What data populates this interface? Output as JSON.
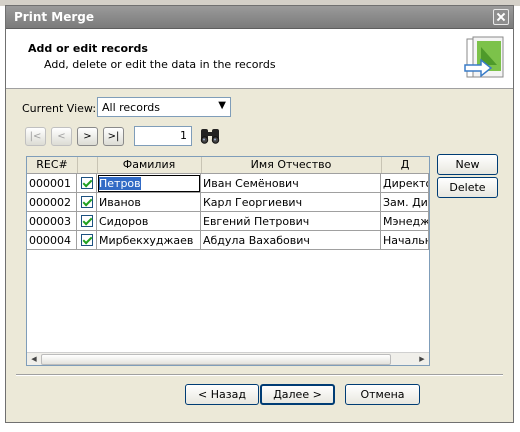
{
  "window": {
    "title": "Print Merge"
  },
  "header": {
    "title": "Add or edit records",
    "subtitle": "Add, delete or edit the data in the records"
  },
  "view": {
    "label": "Current View:",
    "selected": "All records"
  },
  "navigator": {
    "first": "|<",
    "prev": "<",
    "next": ">",
    "last": ">|",
    "record_number": "1"
  },
  "grid": {
    "columns": [
      "REC#",
      "",
      "Фамилия",
      "Имя Отчество",
      "Д"
    ],
    "rows": [
      {
        "rec": "000001",
        "checked": true,
        "surname": "Петров",
        "name": "Иван Семёнович",
        "position": "Директо"
      },
      {
        "rec": "000002",
        "checked": true,
        "surname": "Иванов",
        "name": "Карл Георгиевич",
        "position": "Зам. Дир"
      },
      {
        "rec": "000003",
        "checked": true,
        "surname": "Сидоров",
        "name": "Евгений Петрович",
        "position": "Мэнедж"
      },
      {
        "rec": "000004",
        "checked": true,
        "surname": "Мирбекхуджаев",
        "name": "Абдула Вахабович",
        "position": "Начальн"
      }
    ]
  },
  "side_buttons": {
    "new": "New",
    "delete": "Delete"
  },
  "footer": {
    "back": "< Назад",
    "next": "Далее >",
    "cancel": "Отмена"
  }
}
